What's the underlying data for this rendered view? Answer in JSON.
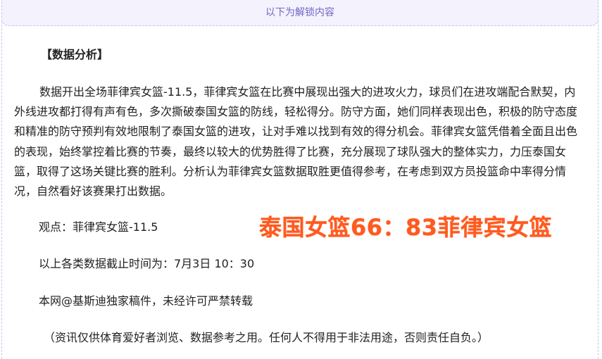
{
  "unlock_bar": {
    "label": "以下为解锁内容"
  },
  "article": {
    "heading": "【数据分析】",
    "analysis": "数据开出全场菲律宾女篮-11.5，菲律宾女篮在比赛中展现出强大的进攻火力，球员们在进攻端配合默契，内外线进攻都打得有声有色，多次撕破泰国女篮的防线，轻松得分。防守方面，她们同样表现出色，积极的防守态度和精准的防守预判有效地限制了泰国女篮的进攻，让对手难以找到有效的得分机会。菲律宾女篮凭借着全面且出色的表现，始终掌控着比赛的节奏，最终以较大的优势胜得了比赛，充分展现了球队强大的整体实力，力压泰国女篮，取得了这场关键比赛的胜利。分析认为菲律宾女篮数据取胜更值得参考，在考虑到双方员投篮命中率得分情况，自然看好该赛果打出数据。",
    "viewpoint": "观点：菲律宾女篮-11.5",
    "cutoff": "以上各类数据截止时间为：7月3日 10：30",
    "copyright": "本网@基斯迪独家稿件，未经许可严禁转载",
    "disclaimer": "（资讯仅供体育爱好者浏览、数据参考之用。任何人不得用于非法用途，否则责任自负。）"
  },
  "score_overlay": {
    "text": "泰国女篮66：83菲律宾女篮",
    "color": "#ff5a1f"
  },
  "colors": {
    "accent": "#7067c4",
    "bar_background": "#f4f2fd",
    "dashed_border": "#c9c3e8"
  }
}
